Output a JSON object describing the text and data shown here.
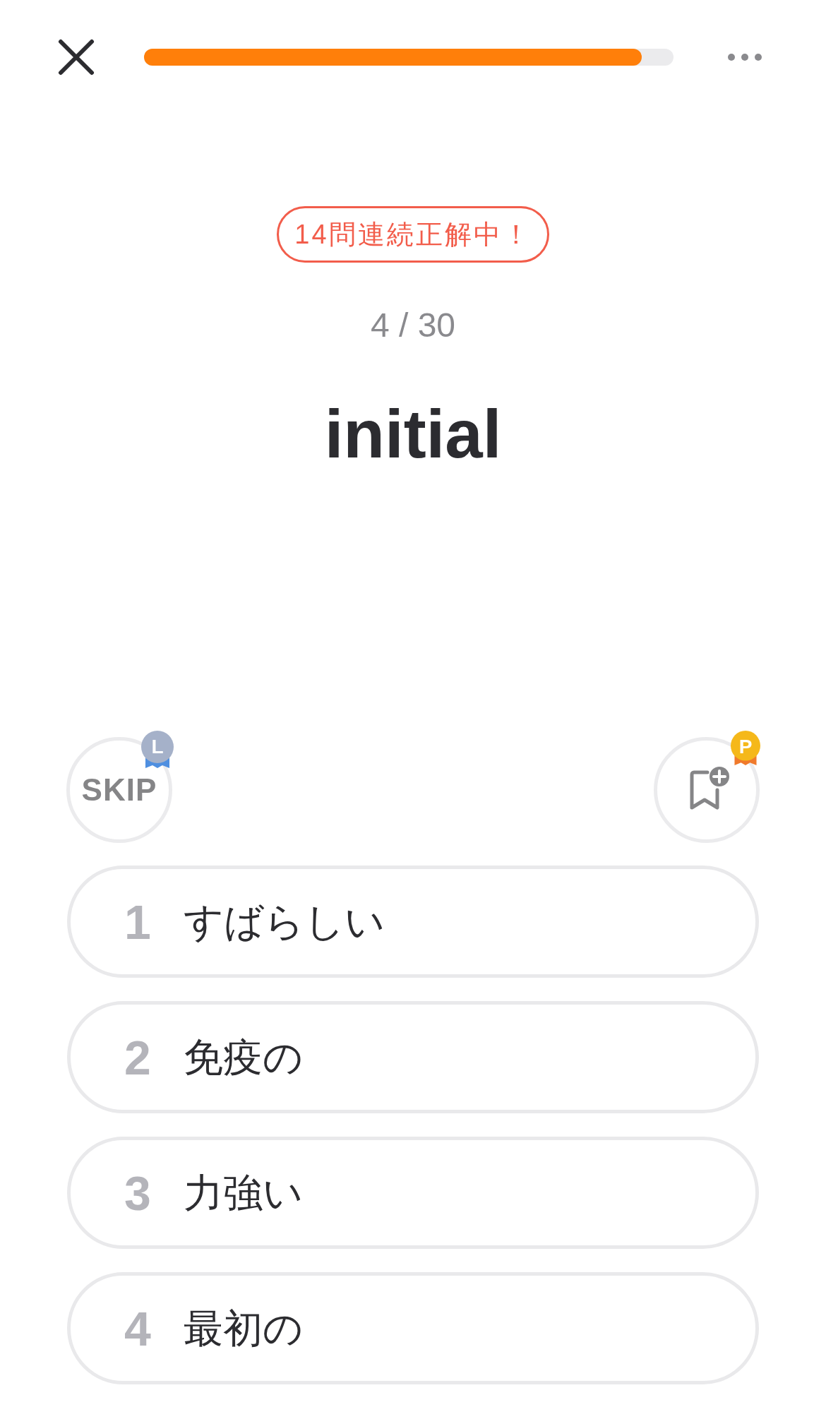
{
  "header": {
    "progress": {
      "level": 0.94
    }
  },
  "streak_badge": "14問連続正解中！",
  "counter": "4 / 30",
  "word": "initial",
  "actions": [
    {
      "kind": "skip",
      "label": "SKIP",
      "medal": "L"
    },
    {
      "kind": "bookmark",
      "medal": "P"
    }
  ],
  "choices": [
    {
      "number": "1",
      "text": "すばらしい"
    },
    {
      "number": "2",
      "text": "免疫の"
    },
    {
      "number": "3",
      "text": "力強い"
    },
    {
      "number": "4",
      "text": "最初の"
    }
  ]
}
